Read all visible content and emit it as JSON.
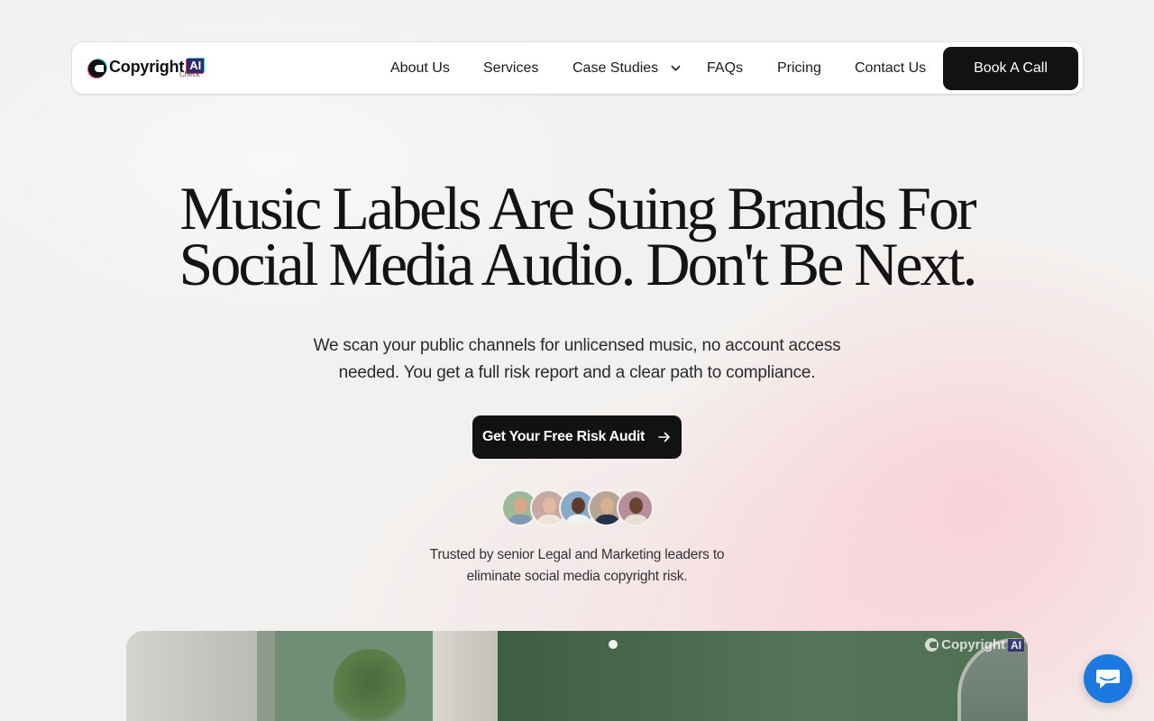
{
  "nav": {
    "logo_text": "Copyright",
    "logo_badge": "AI",
    "logo_sub": "Check",
    "links": [
      "About Us",
      "Services",
      "Case Studies",
      "FAQs",
      "Pricing",
      "Contact Us"
    ],
    "cta_label": "Book A Call"
  },
  "hero": {
    "headline_line1": "Music Labels Are Suing Brands For",
    "headline_line2": "Social Media Audio. Don't Be Next.",
    "subcopy_line1": "We scan your public channels for unlicensed music, no account access",
    "subcopy_line2": "needed. You get a full risk report and a clear path to compliance.",
    "cta_label": "Get Your Free Risk Audit",
    "trust_line1": "Trusted by senior Legal and Marketing leaders to",
    "trust_line2": "eliminate social media copyright risk."
  },
  "video": {
    "watermark_text": "Copyright",
    "watermark_badge": "AI"
  },
  "icons": {
    "dropdown": "chevron-down-icon",
    "cta_arrow": "arrow-right-icon",
    "chat": "chat-bubble-icon"
  },
  "colors": {
    "background": "#f3f1ef",
    "primary_button": "#121212",
    "chat_button": "#1c79e0",
    "badge": "#2b2b6e"
  }
}
